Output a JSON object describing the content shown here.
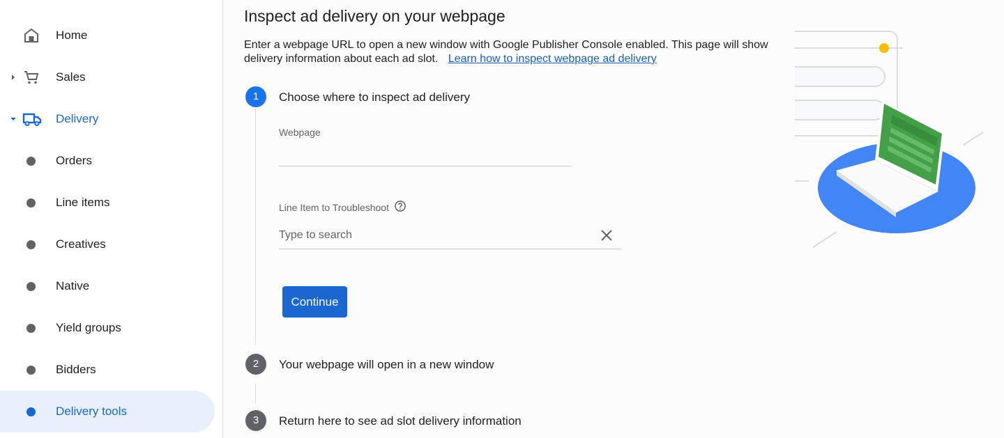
{
  "sidebar": {
    "items": [
      {
        "label": "Home",
        "icon": "home-icon"
      },
      {
        "label": "Sales",
        "icon": "cart-icon",
        "expander": "collapsed"
      },
      {
        "label": "Delivery",
        "icon": "truck-icon",
        "expander": "expanded"
      },
      {
        "label": "Orders"
      },
      {
        "label": "Line items"
      },
      {
        "label": "Creatives"
      },
      {
        "label": "Native"
      },
      {
        "label": "Yield groups"
      },
      {
        "label": "Bidders"
      },
      {
        "label": "Delivery tools",
        "active": true
      }
    ]
  },
  "main": {
    "title": "Inspect ad delivery on your webpage",
    "description": "Enter a webpage URL to open a new window with Google Publisher Console enabled. This page will show delivery information about each ad slot.",
    "learn_link": "Learn how to inspect webpage ad delivery",
    "steps": [
      {
        "number": "1",
        "label": "Choose where to inspect ad delivery",
        "state": "active"
      },
      {
        "number": "2",
        "label": "Your webpage will open in a new window",
        "state": "inactive"
      },
      {
        "number": "3",
        "label": "Return here to see ad slot delivery information",
        "state": "inactive"
      }
    ],
    "webpage_field": {
      "label": "Webpage",
      "value": "",
      "placeholder": ""
    },
    "line_item_field": {
      "label": "Line Item to Troubleshoot",
      "value": "",
      "placeholder": "Type to search"
    },
    "continue_label": "Continue"
  },
  "colors": {
    "accent": "#1a73e8",
    "active_nav_bg": "#e8f0fe",
    "illustration_green": "#43a047",
    "illustration_blue": "#4285f4",
    "illustration_yellow": "#fbbc04"
  }
}
